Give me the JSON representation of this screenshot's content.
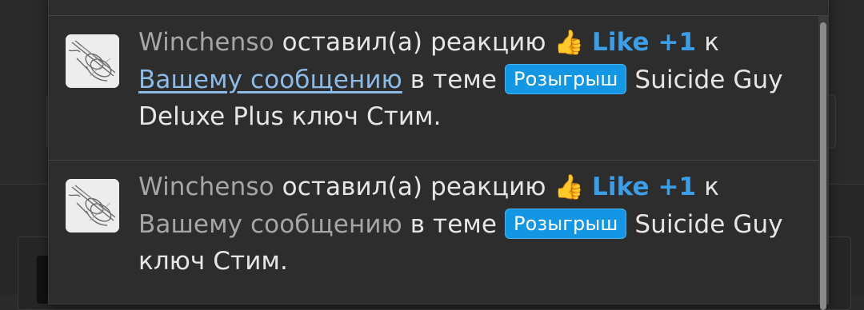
{
  "notifications": [
    {
      "user": "Winchenso",
      "action": "оставил(а) реакцию",
      "emoji": "👍",
      "reaction": "Like +1",
      "to": "к",
      "post_link": "Вашему сообщению",
      "in_thread": "в теме",
      "prefix": "Розыгрыш",
      "thread": "Suicide Guy Deluxe Plus ключ Стим."
    },
    {
      "user": "Winchenso",
      "action": "оставил(а) реакцию",
      "emoji": "👍",
      "reaction": "Like +1",
      "to": "к",
      "post_link": "Вашему сообщению",
      "in_thread": "в теме",
      "prefix": "Розыгрыш",
      "thread": "Suicide Guy ключ Стим."
    }
  ],
  "colors": {
    "accent": "#3d9ee8",
    "badge": "#1396e4",
    "link": "#8cbbe8",
    "background": "#2d2d2d"
  },
  "icons": {
    "reaction": "thumbs-up-icon",
    "avatar": "violin-sketch-avatar"
  }
}
